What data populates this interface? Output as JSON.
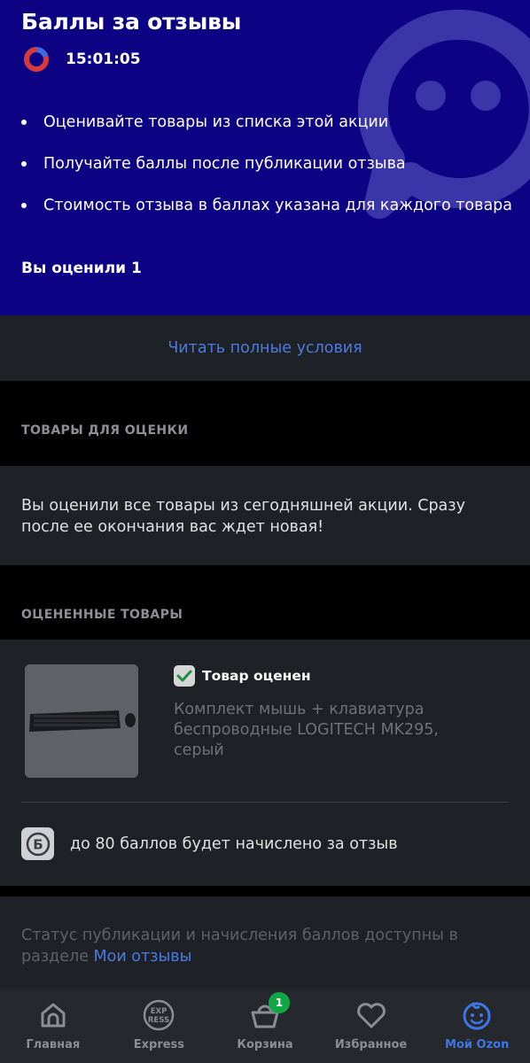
{
  "promo": {
    "title": "Баллы за отзывы",
    "timer": "15:01:05",
    "bullets": [
      "Оценивайте товары из списка этой акции",
      "Получайте баллы после публикации отзыва",
      "Стоимость отзыва в баллах указана для каждого товара"
    ],
    "rated_count_text": "Вы оценили 1",
    "background_color": "#0c0283"
  },
  "conditions": {
    "link_label": "Читать полные условия"
  },
  "to_rate_section": {
    "header": "ТОВАРЫ ДЛЯ ОЦЕНКИ",
    "empty_message": "Вы оценили все товары из сегодняшней акции. Сразу после ее окончания вас ждет новая!"
  },
  "rated_section": {
    "header": "ОЦЕНЕННЫЕ ТОВАРЫ",
    "items": [
      {
        "status": "Товар оценен",
        "name": "Комплект мышь + клавиатура беспроводные LOGITECH MK295, серый",
        "image_icon": "keyboard-mouse-image",
        "bonus_text": "до 80 баллов будет начислено за отзыв",
        "bonus_icon_letter": "Б"
      }
    ]
  },
  "status_notice": {
    "text": "Статус публикации и начисления баллов доступны в разделе ",
    "link_label": "Мои отзывы"
  },
  "bottom_nav": {
    "items": [
      {
        "label": "Главная",
        "icon": "home-icon"
      },
      {
        "label": "Express",
        "icon": "express-icon",
        "icon_text_top": "EXP",
        "icon_text_bottom": "RESS"
      },
      {
        "label": "Корзина",
        "icon": "basket-icon",
        "badge": "1"
      },
      {
        "label": "Избранное",
        "icon": "heart-icon"
      },
      {
        "label": "Мой Ozon",
        "icon": "profile-icon",
        "active": true
      }
    ]
  },
  "colors": {
    "accent_link": "#4b7be0",
    "active_nav": "#3d76e6",
    "badge": "#10a844",
    "card_bg": "#1e2125",
    "page_bg": "#000000"
  }
}
